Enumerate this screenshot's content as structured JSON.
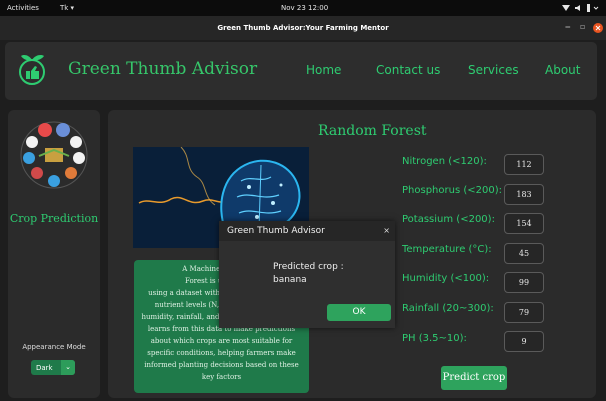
{
  "system_bar": {
    "activities": "Activities",
    "app_menu": "Tk ▾",
    "clock": "Nov 23  12:00"
  },
  "window": {
    "title": "Green Thumb Advisor:Your Farming Mentor"
  },
  "header": {
    "app_title": "Green Thumb Advisor",
    "nav": [
      "Home",
      "Contact us",
      "Services",
      "About"
    ]
  },
  "sidebar": {
    "label": "Crop Prediction",
    "appearance_label": "Appearance Mode",
    "appearance_value": "Dark"
  },
  "main": {
    "model_title": "Random Forest",
    "description_lines": [
      "A Machine learning al",
      "Forest is used to pre",
      "using a dataset with various features like",
      "nutrient levels (N, P, K), temperature,",
      "humidity, rainfall, and soil pH. The algorithm",
      "learns from this data to make predictions",
      "about which crops are most suitable for",
      "specific conditions, helping farmers make",
      "informed planting decisions based on these",
      "key factors"
    ],
    "fields": [
      {
        "label": "Nitrogen (<120):",
        "value": "112"
      },
      {
        "label": "Phosphorus (<200):",
        "value": "183"
      },
      {
        "label": "Potassium (<200):",
        "value": "154"
      },
      {
        "label": "Temperature (°C):",
        "value": "45"
      },
      {
        "label": "Humidity (<100):",
        "value": "99"
      },
      {
        "label": "Rainfall (20~300):",
        "value": "79"
      },
      {
        "label": "PH (3.5~10):",
        "value": "9"
      }
    ],
    "predict_button": "Predict crop"
  },
  "dialog": {
    "title": "Green Thumb Advisor",
    "close": "×",
    "message_line1": "Predicted crop :",
    "message_line2": "banana",
    "ok": "OK"
  },
  "colors": {
    "accent": "#2ecc71",
    "button": "#2ea35d",
    "background": "#1e1e1e",
    "panel": "#2b2b2b"
  }
}
